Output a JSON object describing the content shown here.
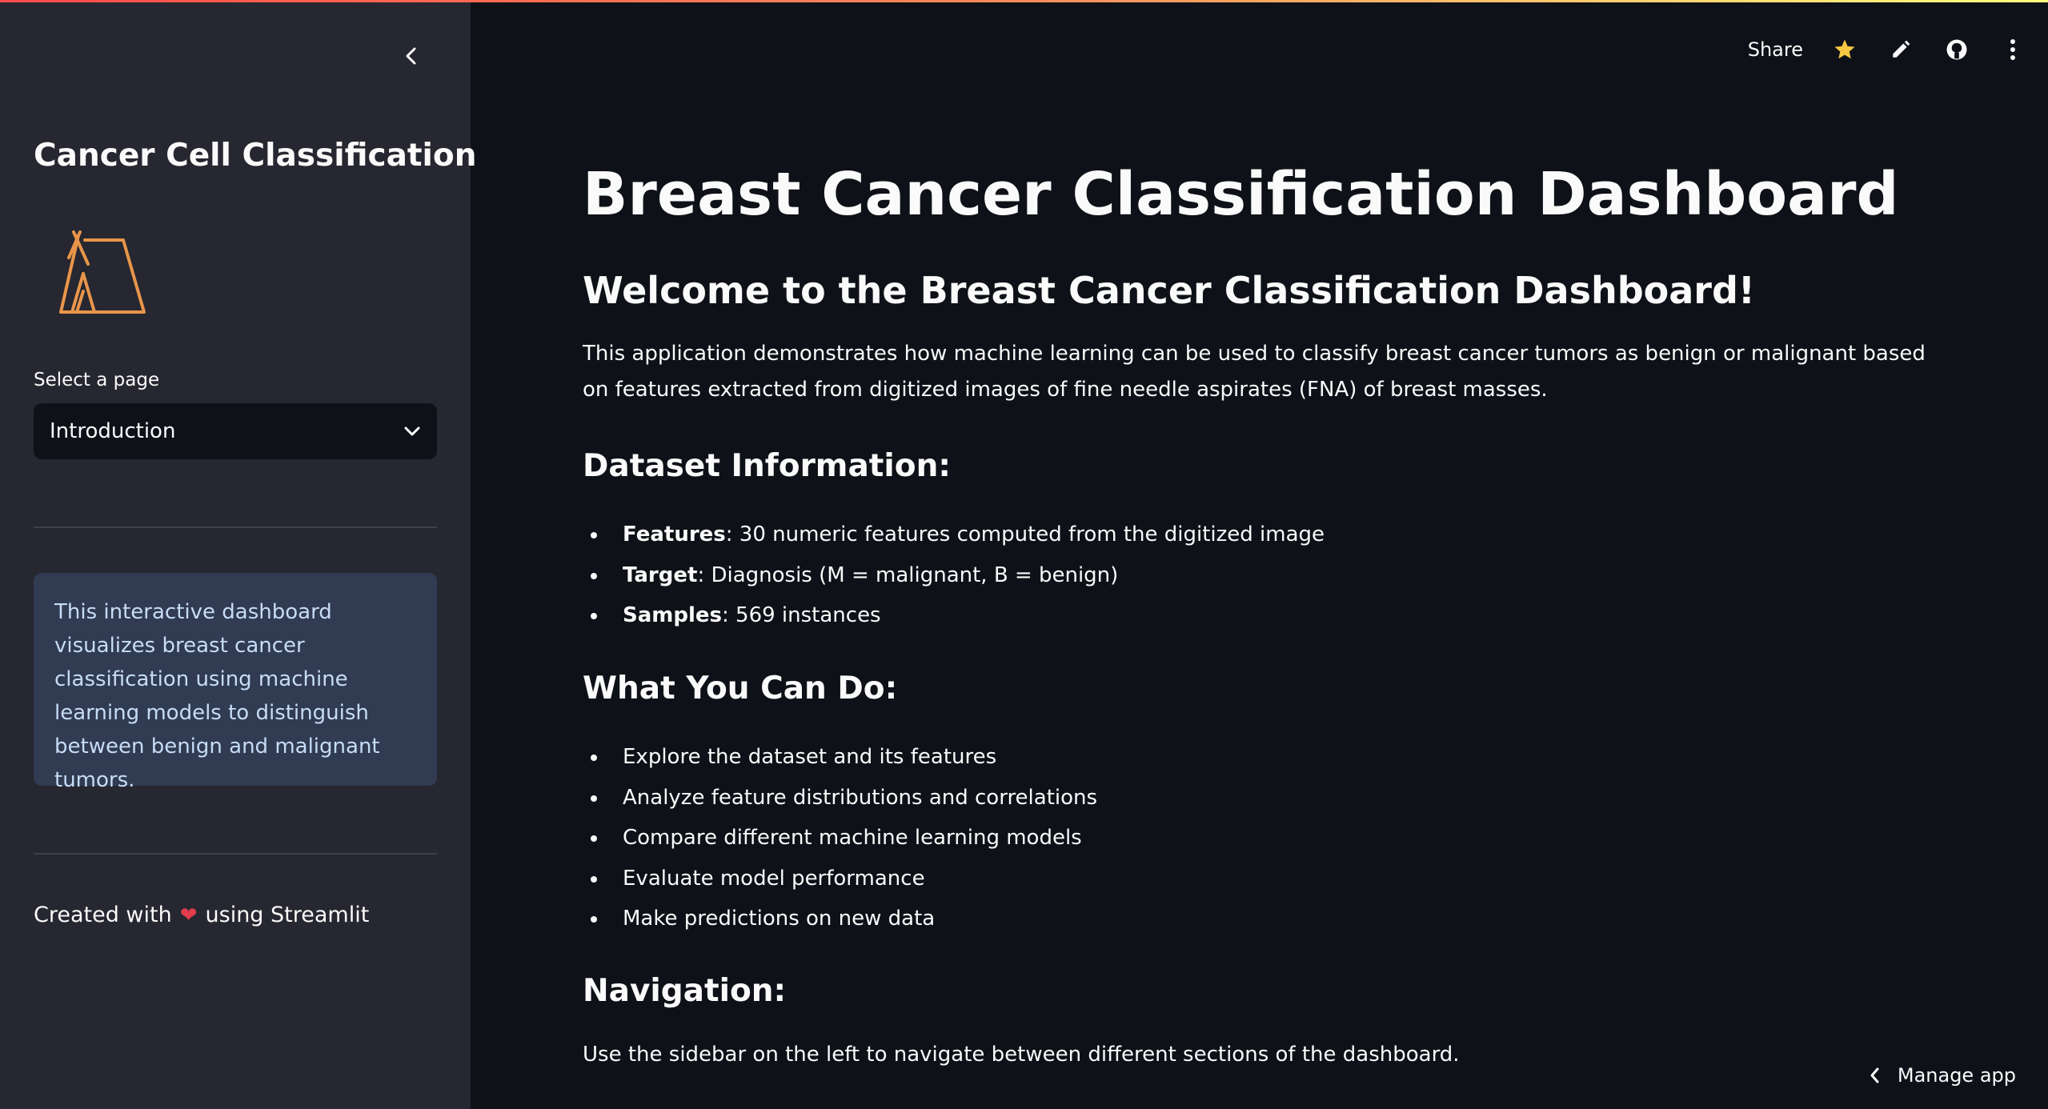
{
  "sidebar": {
    "title": "Cancer Cell Classification",
    "select_label": "Select a page",
    "select_value": "Introduction",
    "info_text": "This interactive dashboard visualizes breast cancer classification using machine learning models to distinguish between benign and malignant tumors.",
    "footer_prefix": "Created with",
    "footer_suffix": "using Streamlit"
  },
  "toolbar": {
    "share_label": "Share"
  },
  "main": {
    "title": "Breast Cancer Classification Dashboard",
    "welcome": "Welcome to the Breast Cancer Classification Dashboard!",
    "intro": "This application demonstrates how machine learning can be used to classify breast cancer tumors as benign or malignant based on features extracted from digitized images of fine needle aspirates (FNA) of breast masses.",
    "dataset_heading": "Dataset Information:",
    "dataset_items": [
      {
        "label": "Features",
        "text": ": 30 numeric features computed from the digitized image"
      },
      {
        "label": "Target",
        "text": ": Diagnosis (M = malignant, B = benign)"
      },
      {
        "label": "Samples",
        "text": ": 569 instances"
      }
    ],
    "can_do_heading": "What You Can Do:",
    "can_do_items": [
      "Explore the dataset and its features",
      "Analyze feature distributions and correlations",
      "Compare different machine learning models",
      "Evaluate model performance",
      "Make predictions on new data"
    ],
    "nav_heading": "Navigation:",
    "nav_text": "Use the sidebar on the left to navigate between different sections of the dashboard."
  },
  "manage_app_label": "Manage app",
  "colors": {
    "background": "#0e1117",
    "sidebar": "#262730",
    "info_box": "#313b52",
    "star": "#f6c744",
    "logo": "#e8954a"
  }
}
